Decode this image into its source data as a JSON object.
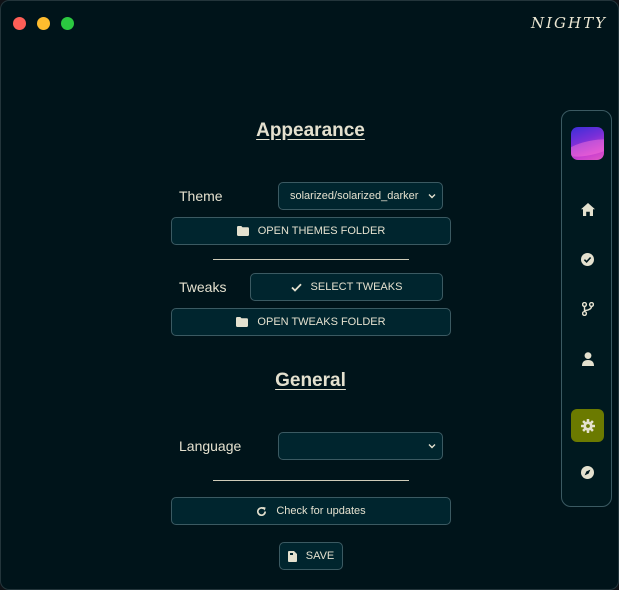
{
  "app": {
    "brand": "NIGHTY"
  },
  "appearance": {
    "title": "Appearance",
    "theme_label": "Theme",
    "theme_value": "solarized/solarized_darker",
    "open_themes_label": "OPEN THEMES FOLDER",
    "tweaks_label": "Tweaks",
    "select_tweaks_label": "SELECT TWEAKS",
    "open_tweaks_label": "OPEN TWEAKS FOLDER"
  },
  "general": {
    "title": "General",
    "language_label": "Language",
    "language_value": "",
    "check_updates_label": "Check for updates",
    "save_label": "SAVE"
  },
  "sidebar": {
    "items": [
      {
        "icon": "home-icon",
        "active": false
      },
      {
        "icon": "check-circle-icon",
        "active": false
      },
      {
        "icon": "branch-icon",
        "active": false
      },
      {
        "icon": "user-icon",
        "active": false
      },
      {
        "icon": "gear-icon",
        "active": true
      },
      {
        "icon": "compass-icon",
        "active": false
      }
    ]
  },
  "colors": {
    "background": "#00141a",
    "control_bg": "#00252e",
    "border": "#3b5a62",
    "text": "#e4e1cf",
    "active_nav": "#6b7a00"
  }
}
